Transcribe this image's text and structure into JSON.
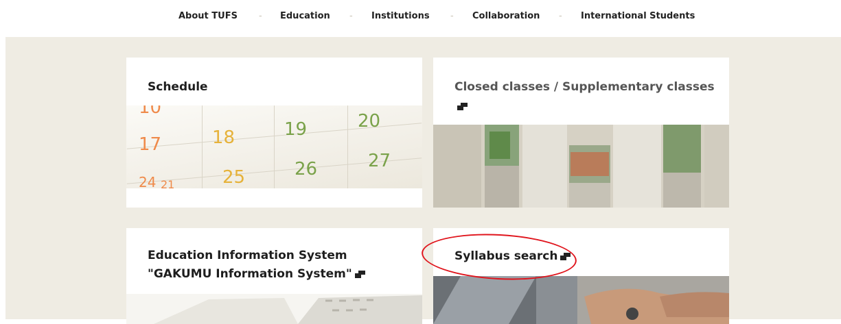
{
  "nav": {
    "items": [
      "About TUFS",
      "Education",
      "Institutions",
      "Collaboration",
      "International Students"
    ],
    "separator": "-"
  },
  "cards": {
    "schedule": {
      "title": "Schedule",
      "calendar_numbers": [
        "10",
        "18",
        "19",
        "20",
        "17",
        "25",
        "26",
        "27",
        "24",
        "21"
      ]
    },
    "closed": {
      "title": "Closed classes / Supplementary classes"
    },
    "edu": {
      "title_line1": "Education Information System",
      "title_line2": "\"GAKUMU Information System\""
    },
    "syllabus": {
      "title": "Syllabus search"
    }
  },
  "colors": {
    "background": "#efece3",
    "annotation": "#e0141c",
    "calendar_orange": "#ef8a4a",
    "calendar_green": "#7aa24a",
    "calendar_yellow": "#e6b23a"
  },
  "icons": {
    "external_link": "external-link-icon"
  }
}
